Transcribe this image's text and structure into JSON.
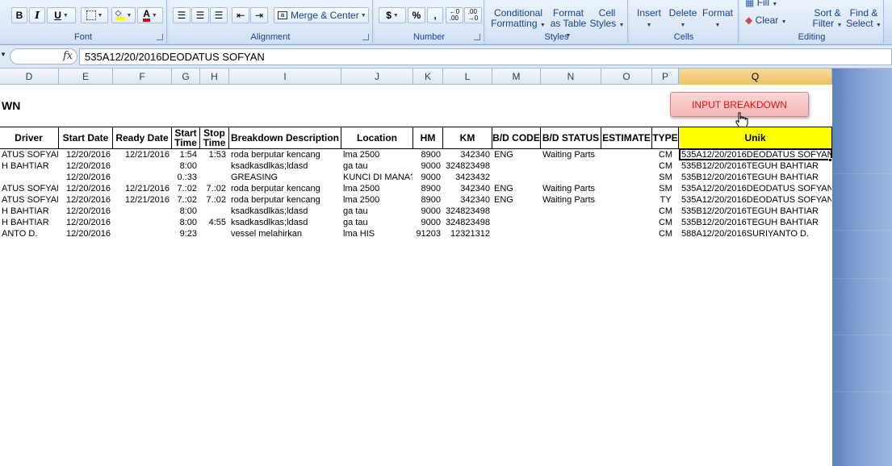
{
  "ribbon": {
    "font_group_label": "Font",
    "alignment_group_label": "Alignment",
    "number_group_label": "Number",
    "styles_group_label": "Styles",
    "cells_group_label": "Cells",
    "editing_group_label": "Editing",
    "bold": "B",
    "italic": "I",
    "underline": "U",
    "font_color_letter": "A",
    "merge_center": "Merge & Center",
    "currency": "$",
    "percent": "%",
    "comma": ",",
    "conditional_formatting_1": "Conditional",
    "conditional_formatting_2": "Formatting",
    "format_as_table_1": "Format",
    "format_as_table_2": "as Table",
    "cell_styles_1": "Cell",
    "cell_styles_2": "Styles",
    "insert": "Insert",
    "delete": "Delete",
    "format": "Format",
    "fill": "Fill",
    "clear": "Clear",
    "sort_filter_1": "Sort &",
    "sort_filter_2": "Filter",
    "find_select_1": "Find &",
    "find_select_2": "Select"
  },
  "formula_bar": {
    "fx": "fx",
    "content": "535A12/20/2016DEODATUS SOFYAN"
  },
  "columns": [
    "D",
    "E",
    "F",
    "G",
    "H",
    "I",
    "J",
    "K",
    "L",
    "M",
    "N",
    "O",
    "P",
    "Q"
  ],
  "sheet": {
    "title_fragment": "WN",
    "input_button": "INPUT BREAKDOWN",
    "headers": {
      "driver": "Driver",
      "start_date": "Start Date",
      "ready_date": "Ready Date",
      "start_time": "Start Time",
      "stop_time": "Stop Time",
      "description": "Breakdown Description",
      "location": "Location",
      "hm": "HM",
      "km": "KM",
      "bd_code": "B/D CODE",
      "bd_status": "B/D STATUS",
      "estimate": "ESTIMATE",
      "type": "TYPE",
      "unik": "Unik"
    },
    "rows": [
      {
        "driver": "ATUS SOFYAN",
        "start_date": "12/20/2016",
        "ready_date": "12/21/2016",
        "start_time": "1:54",
        "stop_time": "1:53",
        "desc": "roda berputar kencang",
        "loc": "lma 2500",
        "hm": "8900",
        "km": "342340",
        "code": "ENG",
        "status": "Waiting Parts",
        "est": "",
        "type": "CM",
        "unik": "535A12/20/2016DEODATUS SOFYAN"
      },
      {
        "driver": "H BAHTIAR",
        "start_date": "12/20/2016",
        "ready_date": "",
        "start_time": "8:00",
        "stop_time": "",
        "desc": "ksadkasdlkas;ldasd",
        "loc": "ga tau",
        "hm": "9000",
        "km": "324823498",
        "code": "",
        "status": "",
        "est": "",
        "type": "CM",
        "unik": "535B12/20/2016TEGUH BAHTIAR"
      },
      {
        "driver": "",
        "start_date": "12/20/2016",
        "ready_date": "",
        "start_time": "0.:33",
        "stop_time": "",
        "desc": "GREASING",
        "loc": "KUNCI DI MANA?",
        "hm": "9000",
        "km": "3423432",
        "code": "",
        "status": "",
        "est": "",
        "type": "SM",
        "unik": "535B12/20/2016TEGUH BAHTIAR"
      },
      {
        "driver": "ATUS SOFYAN",
        "start_date": "12/20/2016",
        "ready_date": "12/21/2016",
        "start_time": "7.:02",
        "stop_time": "7.:02",
        "desc": "roda berputar kencang",
        "loc": "lma 2500",
        "hm": "8900",
        "km": "342340",
        "code": "ENG",
        "status": "Waiting Parts",
        "est": "",
        "type": "SM",
        "unik": "535A12/20/2016DEODATUS SOFYAN"
      },
      {
        "driver": "ATUS SOFYAN",
        "start_date": "12/20/2016",
        "ready_date": "12/21/2016",
        "start_time": "7.:02",
        "stop_time": "7.:02",
        "desc": "roda berputar kencang",
        "loc": "lma 2500",
        "hm": "8900",
        "km": "342340",
        "code": "ENG",
        "status": "Waiting Parts",
        "est": "",
        "type": "TY",
        "unik": "535A12/20/2016DEODATUS SOFYAN"
      },
      {
        "driver": "H BAHTIAR",
        "start_date": "12/20/2016",
        "ready_date": "",
        "start_time": "8:00",
        "stop_time": "",
        "desc": "ksadkasdlkas;ldasd",
        "loc": "ga tau",
        "hm": "9000",
        "km": "324823498",
        "code": "",
        "status": "",
        "est": "",
        "type": "CM",
        "unik": "535B12/20/2016TEGUH BAHTIAR"
      },
      {
        "driver": "H BAHTIAR",
        "start_date": "12/20/2016",
        "ready_date": "",
        "start_time": "8:00",
        "stop_time": "4:55",
        "desc": "ksadkasdlkas;ldasd",
        "loc": "ga tau",
        "hm": "9000",
        "km": "324823498",
        "code": "",
        "status": "",
        "est": "",
        "type": "CM",
        "unik": "535B12/20/2016TEGUH BAHTIAR"
      },
      {
        "driver": "ANTO D.",
        "start_date": "12/20/2016",
        "ready_date": "",
        "start_time": "9:23",
        "stop_time": "",
        "desc": "vessel melahirkan",
        "loc": "lma HIS",
        "hm": "91203",
        "km": "12321312",
        "code": "",
        "status": "",
        "est": "",
        "type": "CM",
        "unik": "588A12/20/2016SURIYANTO D."
      }
    ]
  },
  "colors": {
    "unik_header": "#ffff00",
    "button_text": "#e31111",
    "selected_column": "#f1c15f"
  }
}
